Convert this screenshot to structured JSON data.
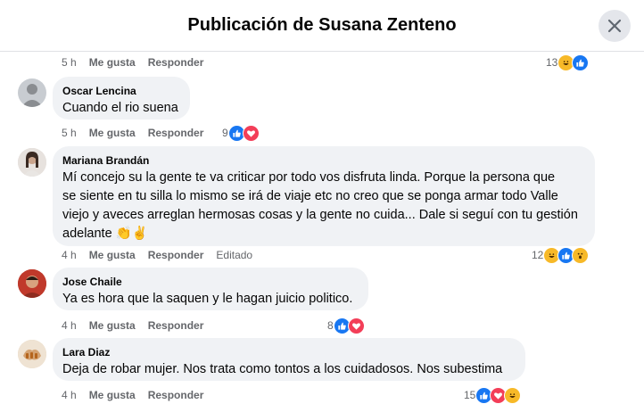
{
  "header": {
    "title": "Publicación de Susana Zenteno",
    "close_icon": "close-icon"
  },
  "labels": {
    "like": "Me gusta",
    "reply": "Responder",
    "edited": "Editado"
  },
  "top_meta": {
    "time": "5 h",
    "reaction_count": "13",
    "reactions": [
      "haha",
      "like"
    ]
  },
  "comments": [
    {
      "author": "Oscar Lencina",
      "text": "Cuando el rio suena",
      "time": "5 h",
      "reaction_count": "9",
      "reactions": [
        "like",
        "love"
      ]
    },
    {
      "author": "Mariana Brandán",
      "text_lines": [
        "Mí concejo su la gente te va criticar por todo vos disfruta linda. Porque la persona que",
        "se siente en tu silla lo mismo se irá de viaje etc no creo que se ponga armar todo Valle",
        "viejo y aveces arreglan hermosas cosas y la gente no cuida... Dale si seguí con tu gestión",
        "adelante 👏✌"
      ],
      "time": "4 h",
      "edited": true,
      "reaction_count": "12",
      "reactions": [
        "haha",
        "like",
        "wow"
      ]
    },
    {
      "author": "Jose Chaile",
      "text": "Ya es hora que la saquen y le hagan juicio politico.",
      "time": "4 h",
      "reaction_count": "8",
      "reactions": [
        "like",
        "love"
      ]
    },
    {
      "author": "Lara Diaz",
      "text": "Deja de robar mujer. Nos trata como tontos a los cuidadosos. Nos subestima",
      "time": "4 h",
      "reaction_count": "15",
      "reactions": [
        "like",
        "love",
        "haha"
      ]
    }
  ]
}
